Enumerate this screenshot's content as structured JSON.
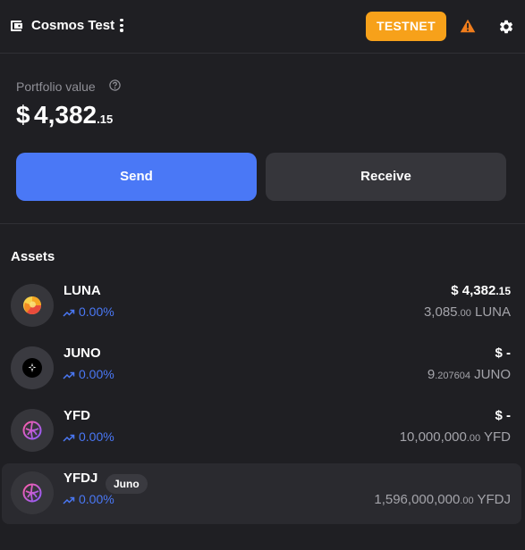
{
  "header": {
    "wallet_name": "Cosmos Test",
    "network_badge": "TESTNET",
    "badge_color": "#f7a11a",
    "icons": [
      "wallet-icon",
      "more-vertical-icon",
      "warning-icon",
      "gear-icon"
    ]
  },
  "portfolio": {
    "label": "Portfolio value",
    "currency": "$",
    "value_integer": "4,382",
    "value_decimal": ".15",
    "send_label": "Send",
    "receive_label": "Receive",
    "accent_color": "#4a78f6"
  },
  "assets": {
    "title": "Assets",
    "items": [
      {
        "symbol": "LUNA",
        "change": "0.00%",
        "value_integer": "$ 4,382",
        "value_decimal": ".15",
        "balance_integer": "3,085",
        "balance_decimal": ".00",
        "balance_unit": "LUNA",
        "chip": ""
      },
      {
        "symbol": "JUNO",
        "change": "0.00%",
        "value_integer": "$ -",
        "value_decimal": "",
        "balance_integer": "9",
        "balance_decimal": ".207604",
        "balance_unit": "JUNO",
        "chip": ""
      },
      {
        "symbol": "YFD",
        "change": "0.00%",
        "value_integer": "$ -",
        "value_decimal": "",
        "balance_integer": "10,000,000",
        "balance_decimal": ".00",
        "balance_unit": "YFD",
        "chip": ""
      },
      {
        "symbol": "YFDJ",
        "change": "0.00%",
        "value_integer": "",
        "value_decimal": "",
        "balance_integer": "1,596,000,000",
        "balance_decimal": ".00",
        "balance_unit": "YFDJ",
        "chip": "Juno"
      }
    ]
  }
}
